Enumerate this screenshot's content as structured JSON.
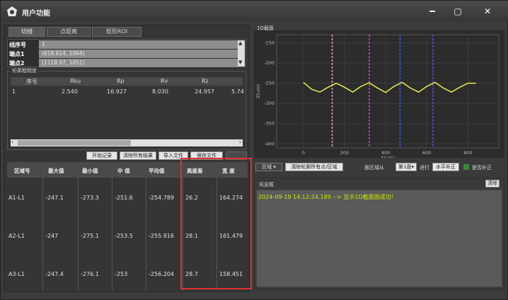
{
  "window": {
    "title": "用户功能",
    "min": "━",
    "max": "▢",
    "close": "✕"
  },
  "tabs": [
    "切线",
    "点距离",
    "矩形ROI"
  ],
  "line_info": [
    {
      "key": "线序号",
      "value": "1"
    },
    {
      "key": "端点1",
      "value": "(618.614, 1064)"
    },
    {
      "key": "端点2",
      "value": "(1118.97, 1051)"
    }
  ],
  "roughness": {
    "legend": "轮廓粗糙度",
    "headers": [
      "序号",
      "Rku",
      "Rp",
      "Rv",
      "Rz",
      ""
    ],
    "row": [
      "1",
      "2.540",
      "16.927",
      "8.030",
      "24.957",
      "5.74"
    ]
  },
  "buttons": [
    "开始记录",
    "清除所有结果",
    "导入文件",
    "保存文件"
  ],
  "regions": {
    "headers": [
      "区域号",
      "最大值",
      "最小值",
      "中 值",
      "平均值",
      "高度差",
      "宽 度"
    ],
    "rows": [
      [
        "A1-L1",
        "-247.1",
        "-273.3",
        "-251.6",
        "-254.789",
        "26.2",
        "164.274"
      ],
      [
        "A2-L1",
        "-247",
        "-275.1",
        "-253.5",
        "-255.916",
        "28.1",
        "161.479"
      ],
      [
        "A3-L1",
        "-247.4",
        "-276.1",
        "-253",
        "-256.204",
        "28.7",
        "158.451"
      ]
    ]
  },
  "chart_data": {
    "type": "line",
    "title": "1D截面",
    "xlabel": "X(um)",
    "ylabel": "Z(um)",
    "xlim": [
      -130,
      950
    ],
    "ylim": [
      -410,
      -130
    ],
    "x_ticks": [
      0,
      200,
      400,
      600,
      800
    ],
    "y_ticks": [
      -150,
      -200,
      -250,
      -300,
      -350,
      -400
    ],
    "series": [
      {
        "x": [
          0,
          40,
          80,
          120,
          160,
          200,
          240,
          280,
          320,
          360,
          400,
          440,
          480,
          520,
          560,
          600,
          640,
          680,
          720,
          760,
          800,
          840
        ],
        "y": [
          -248,
          -265,
          -272,
          -260,
          -250,
          -260,
          -272,
          -258,
          -249,
          -262,
          -273,
          -258,
          -248,
          -262,
          -272,
          -258,
          -248,
          -262,
          -272,
          -260,
          -250,
          -250
        ]
      }
    ],
    "markers": [
      {
        "x": 140,
        "color": "#e6a0c0"
      },
      {
        "x": 320,
        "color": "#cc44cc"
      },
      {
        "x": 470,
        "color": "#3a5aff"
      },
      {
        "x": 630,
        "color": "#5a4aff"
      }
    ],
    "line_color": "#ecec50",
    "grid": true
  },
  "controls": {
    "region_select": "区域",
    "clear_regions": "清除轮廓所有点/区域",
    "face_label": "面区域从",
    "face_value": "第1面",
    "run_label": "进行",
    "level_btn": "水平补正",
    "compensate": "是否补正"
  },
  "message": {
    "title": "讯息框",
    "clear": "清除",
    "line": "2024-09-19 14:12:24.189 --> 显示1D截面图成功!"
  }
}
